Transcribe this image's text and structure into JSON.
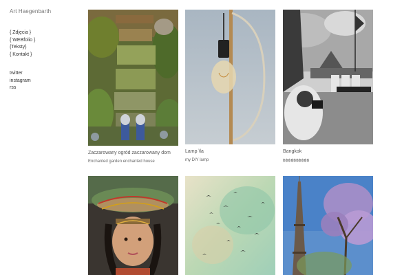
{
  "site": {
    "title": "Art Haegenbarth"
  },
  "nav": [
    {
      "label": "{ Zdjęcia }"
    },
    {
      "label": "{ WEBfolio }"
    },
    {
      "label": "{Teksty}"
    },
    {
      "label": "{ Kontakt }"
    }
  ],
  "social": [
    {
      "label": "twitter"
    },
    {
      "label": "instagram"
    },
    {
      "label": "rss"
    }
  ],
  "tiles": [
    {
      "title": "Zaczarowany ogród zaczarowany dom",
      "subtitle": "Enchanted garden enchanted house",
      "image": "garden-steps-photo"
    },
    {
      "title": "Lamp \\la",
      "subtitle": "my DIY lamp",
      "image": "edison-lamp-photo"
    },
    {
      "title": "Bangkok",
      "subtitle": "฿฿฿฿฿฿฿฿฿฿",
      "image": "bangkok-photo"
    },
    {
      "title": "",
      "subtitle": "",
      "image": "headdress-portrait-photo"
    },
    {
      "title": "",
      "subtitle": "",
      "image": "birds-watercolor-photo"
    },
    {
      "title": "",
      "subtitle": "",
      "image": "eiffel-tower-photo"
    }
  ]
}
